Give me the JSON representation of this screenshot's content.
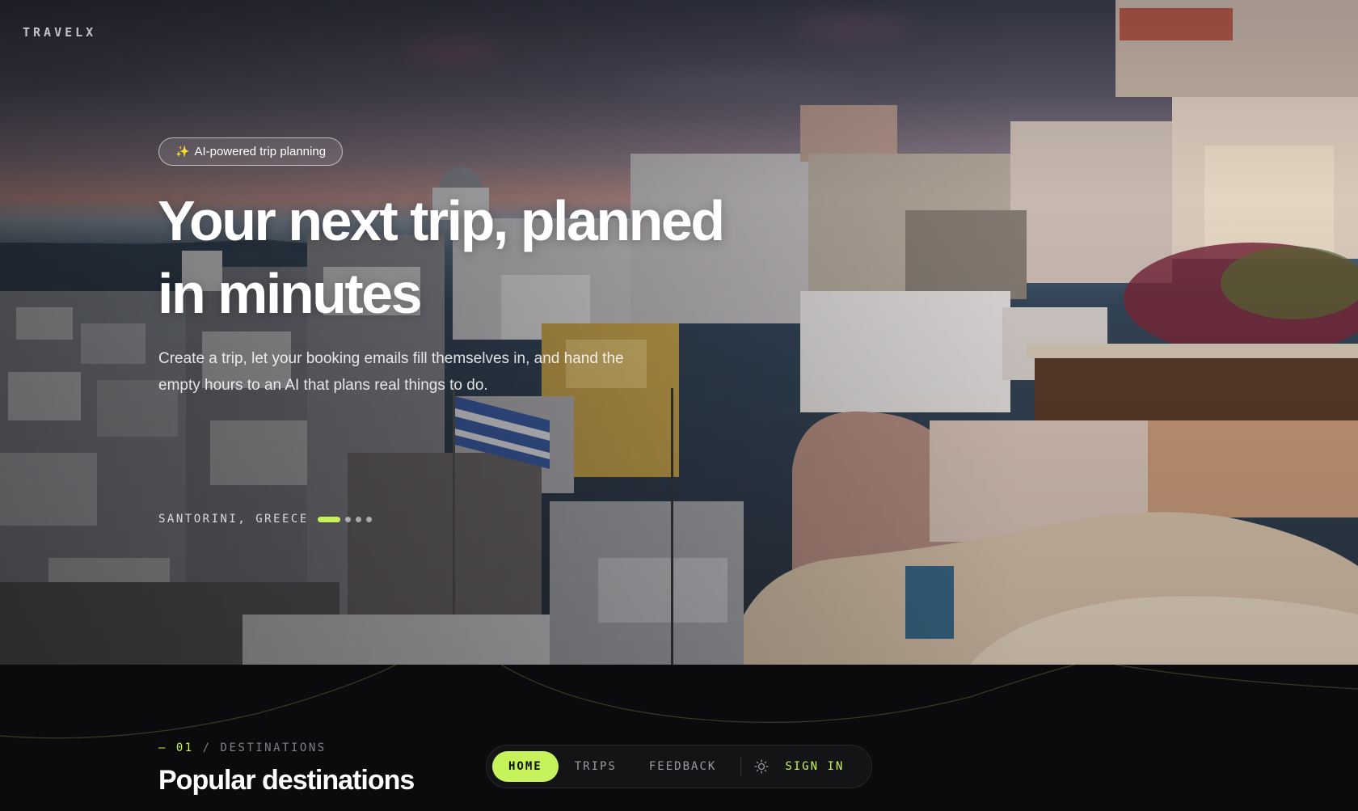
{
  "brand": {
    "name": "TRAVELX"
  },
  "hero": {
    "badge": {
      "icon": "sparkles-icon",
      "label": "AI-powered trip planning"
    },
    "headline_line1": "Your next trip, planned",
    "headline_line2": "in minutes",
    "subtitle_line1": "Create a trip, let your booking emails fill themselves in, and hand the",
    "subtitle_line2": "empty hours to an AI that plans real things to do.",
    "location": "SANTORINI, GREECE",
    "carousel": {
      "total": 4,
      "active_index": 0
    }
  },
  "section": {
    "number": "— 01",
    "divider": "/",
    "label": "DESTINATIONS",
    "title": "Popular destinations"
  },
  "nav": {
    "items": [
      {
        "label": "HOME",
        "active": true
      },
      {
        "label": "TRIPS",
        "active": false
      },
      {
        "label": "FEEDBACK",
        "active": false
      }
    ],
    "theme_icon": "sun-icon",
    "sign_in": "SIGN IN"
  },
  "colors": {
    "accent": "#c6f35b",
    "background": "#0b0b0e"
  }
}
